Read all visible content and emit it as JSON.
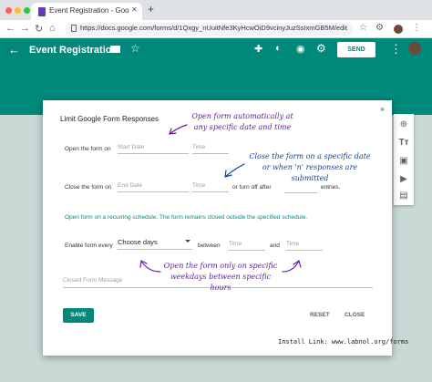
{
  "browser": {
    "tab_title": "Event Registration - Google Fo",
    "tab_close": "✕",
    "new_tab": "+",
    "url": "https://docs.google.com/forms/d/1Qxgy_nUuitNfe3KyHcwOiD9vcinyJuzSsIxmGB5M/edit"
  },
  "header": {
    "title": "Event Registration",
    "send_label": "SEND"
  },
  "dialog": {
    "title": "Limit Google Form Responses",
    "close": "×",
    "open_label": "Open the form on",
    "open_date_placeholder": "Start Date",
    "open_time_placeholder": "Time",
    "close_label": "Close the form on",
    "close_date_placeholder": "End Date",
    "close_time_placeholder": "Time",
    "turn_off_label": "or turn off after",
    "entries_label": "entries.",
    "recurring_info": "Open form on a recurring schedule. The form remains closed outside the specified schedule.",
    "enable_label": "Enable form every",
    "days_value": "Choose days",
    "between_label": "between",
    "from_time_placeholder": "Time",
    "and_label": "and",
    "to_time_placeholder": "Time",
    "closed_message_placeholder": "Closed Form Message",
    "save_label": "SAVE",
    "reset_label": "RESET",
    "close_button_label": "CLOSE"
  },
  "annotations": {
    "open_note": [
      "Open form automatically at",
      "any specific date and time"
    ],
    "close_note": [
      "Close the form on a specific date",
      "or when 'n' responses are submitted"
    ],
    "weekday_note": [
      "Open the form only on specific",
      "weekdays between specific hours"
    ],
    "install": "Install Link: www.labnol.org/forms"
  },
  "colors": {
    "accent": "#00897b",
    "purple_note": "#6a1b9a",
    "blue_note": "#0d47a1"
  }
}
